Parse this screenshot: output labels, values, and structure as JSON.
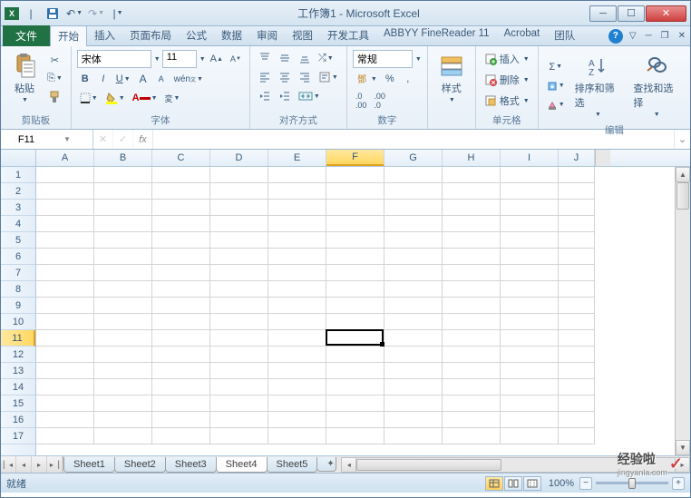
{
  "title": "工作簿1 - Microsoft Excel",
  "tabs": {
    "file": "文件",
    "items": [
      "开始",
      "插入",
      "页面布局",
      "公式",
      "数据",
      "审阅",
      "视图",
      "开发工具",
      "ABBYY FineReader 11",
      "Acrobat",
      "团队"
    ],
    "active": 0
  },
  "ribbon": {
    "clipboard": {
      "paste": "粘贴",
      "label": "剪贴板"
    },
    "font": {
      "name": "宋体",
      "size": "11",
      "label": "字体"
    },
    "alignment": {
      "label": "对齐方式"
    },
    "number": {
      "format": "常规",
      "label": "数字"
    },
    "styles": {
      "styles_btn": "样式"
    },
    "cells": {
      "insert": "插入",
      "delete": "删除",
      "format": "格式",
      "label": "单元格"
    },
    "editing": {
      "sort": "排序和筛选",
      "find": "查找和选择",
      "label": "编辑"
    }
  },
  "formula_bar": {
    "cell_ref": "F11",
    "formula": ""
  },
  "grid": {
    "columns": [
      "A",
      "B",
      "C",
      "D",
      "E",
      "F",
      "G",
      "H",
      "I",
      "J"
    ],
    "rows": [
      "1",
      "2",
      "3",
      "4",
      "5",
      "6",
      "7",
      "8",
      "9",
      "10",
      "11",
      "12",
      "13",
      "14",
      "15",
      "16",
      "17"
    ],
    "selected_col_idx": 5,
    "selected_row_idx": 10
  },
  "sheets": {
    "tabs": [
      "Sheet1",
      "Sheet2",
      "Sheet3",
      "Sheet4",
      "Sheet5"
    ],
    "active": 3
  },
  "status": {
    "text": "就绪",
    "zoom": "100%"
  },
  "watermark": {
    "text": "经验啦",
    "sub": "jingyanla.com"
  }
}
